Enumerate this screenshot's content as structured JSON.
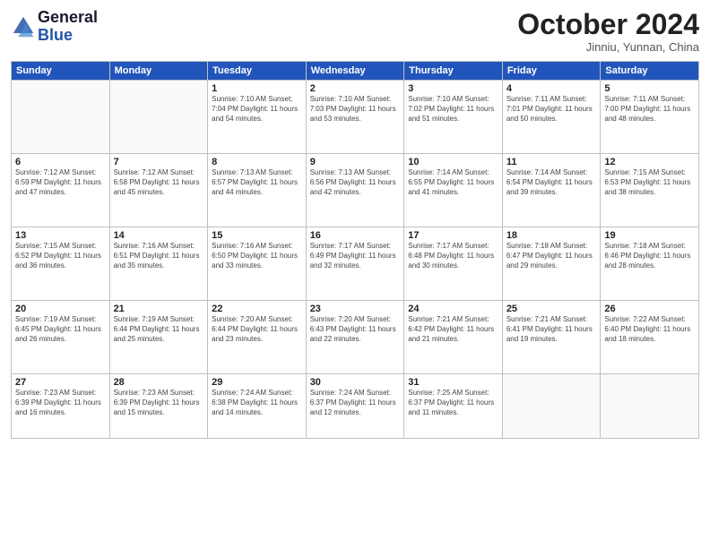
{
  "header": {
    "logo_general": "General",
    "logo_blue": "Blue",
    "month": "October 2024",
    "location": "Jinniu, Yunnan, China"
  },
  "days_of_week": [
    "Sunday",
    "Monday",
    "Tuesday",
    "Wednesday",
    "Thursday",
    "Friday",
    "Saturday"
  ],
  "weeks": [
    [
      {
        "day": "",
        "info": ""
      },
      {
        "day": "",
        "info": ""
      },
      {
        "day": "1",
        "info": "Sunrise: 7:10 AM\nSunset: 7:04 PM\nDaylight: 11 hours and 54 minutes."
      },
      {
        "day": "2",
        "info": "Sunrise: 7:10 AM\nSunset: 7:03 PM\nDaylight: 11 hours and 53 minutes."
      },
      {
        "day": "3",
        "info": "Sunrise: 7:10 AM\nSunset: 7:02 PM\nDaylight: 11 hours and 51 minutes."
      },
      {
        "day": "4",
        "info": "Sunrise: 7:11 AM\nSunset: 7:01 PM\nDaylight: 11 hours and 50 minutes."
      },
      {
        "day": "5",
        "info": "Sunrise: 7:11 AM\nSunset: 7:00 PM\nDaylight: 11 hours and 48 minutes."
      }
    ],
    [
      {
        "day": "6",
        "info": "Sunrise: 7:12 AM\nSunset: 6:59 PM\nDaylight: 11 hours and 47 minutes."
      },
      {
        "day": "7",
        "info": "Sunrise: 7:12 AM\nSunset: 6:58 PM\nDaylight: 11 hours and 45 minutes."
      },
      {
        "day": "8",
        "info": "Sunrise: 7:13 AM\nSunset: 6:57 PM\nDaylight: 11 hours and 44 minutes."
      },
      {
        "day": "9",
        "info": "Sunrise: 7:13 AM\nSunset: 6:56 PM\nDaylight: 11 hours and 42 minutes."
      },
      {
        "day": "10",
        "info": "Sunrise: 7:14 AM\nSunset: 6:55 PM\nDaylight: 11 hours and 41 minutes."
      },
      {
        "day": "11",
        "info": "Sunrise: 7:14 AM\nSunset: 6:54 PM\nDaylight: 11 hours and 39 minutes."
      },
      {
        "day": "12",
        "info": "Sunrise: 7:15 AM\nSunset: 6:53 PM\nDaylight: 11 hours and 38 minutes."
      }
    ],
    [
      {
        "day": "13",
        "info": "Sunrise: 7:15 AM\nSunset: 6:52 PM\nDaylight: 11 hours and 36 minutes."
      },
      {
        "day": "14",
        "info": "Sunrise: 7:16 AM\nSunset: 6:51 PM\nDaylight: 11 hours and 35 minutes."
      },
      {
        "day": "15",
        "info": "Sunrise: 7:16 AM\nSunset: 6:50 PM\nDaylight: 11 hours and 33 minutes."
      },
      {
        "day": "16",
        "info": "Sunrise: 7:17 AM\nSunset: 6:49 PM\nDaylight: 11 hours and 32 minutes."
      },
      {
        "day": "17",
        "info": "Sunrise: 7:17 AM\nSunset: 6:48 PM\nDaylight: 11 hours and 30 minutes."
      },
      {
        "day": "18",
        "info": "Sunrise: 7:18 AM\nSunset: 6:47 PM\nDaylight: 11 hours and 29 minutes."
      },
      {
        "day": "19",
        "info": "Sunrise: 7:18 AM\nSunset: 6:46 PM\nDaylight: 11 hours and 28 minutes."
      }
    ],
    [
      {
        "day": "20",
        "info": "Sunrise: 7:19 AM\nSunset: 6:45 PM\nDaylight: 11 hours and 26 minutes."
      },
      {
        "day": "21",
        "info": "Sunrise: 7:19 AM\nSunset: 6:44 PM\nDaylight: 11 hours and 25 minutes."
      },
      {
        "day": "22",
        "info": "Sunrise: 7:20 AM\nSunset: 6:44 PM\nDaylight: 11 hours and 23 minutes."
      },
      {
        "day": "23",
        "info": "Sunrise: 7:20 AM\nSunset: 6:43 PM\nDaylight: 11 hours and 22 minutes."
      },
      {
        "day": "24",
        "info": "Sunrise: 7:21 AM\nSunset: 6:42 PM\nDaylight: 11 hours and 21 minutes."
      },
      {
        "day": "25",
        "info": "Sunrise: 7:21 AM\nSunset: 6:41 PM\nDaylight: 11 hours and 19 minutes."
      },
      {
        "day": "26",
        "info": "Sunrise: 7:22 AM\nSunset: 6:40 PM\nDaylight: 11 hours and 18 minutes."
      }
    ],
    [
      {
        "day": "27",
        "info": "Sunrise: 7:23 AM\nSunset: 6:39 PM\nDaylight: 11 hours and 16 minutes."
      },
      {
        "day": "28",
        "info": "Sunrise: 7:23 AM\nSunset: 6:39 PM\nDaylight: 11 hours and 15 minutes."
      },
      {
        "day": "29",
        "info": "Sunrise: 7:24 AM\nSunset: 6:38 PM\nDaylight: 11 hours and 14 minutes."
      },
      {
        "day": "30",
        "info": "Sunrise: 7:24 AM\nSunset: 6:37 PM\nDaylight: 11 hours and 12 minutes."
      },
      {
        "day": "31",
        "info": "Sunrise: 7:25 AM\nSunset: 6:37 PM\nDaylight: 11 hours and 11 minutes."
      },
      {
        "day": "",
        "info": ""
      },
      {
        "day": "",
        "info": ""
      }
    ]
  ]
}
